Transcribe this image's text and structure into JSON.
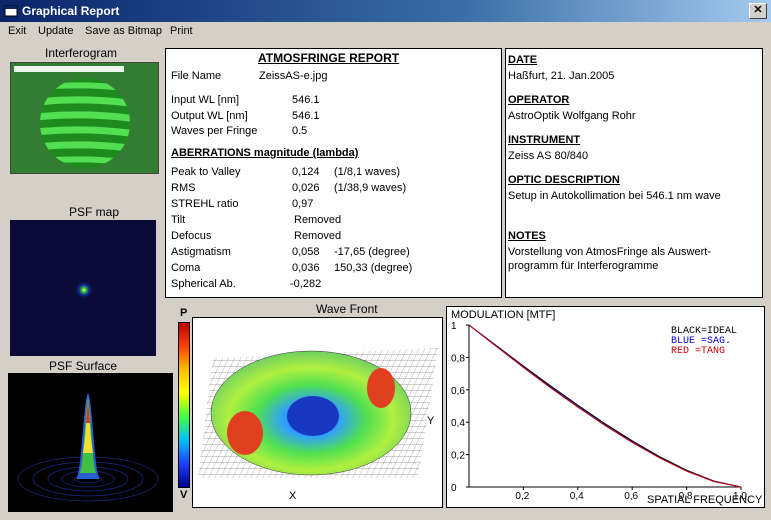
{
  "window": {
    "title": "Graphical Report",
    "close_glyph": "✕"
  },
  "menu": [
    "Exit",
    "Update",
    "Save as Bitmap",
    "Print"
  ],
  "thumbs": {
    "interferogram_label": "Interferogram",
    "psf_map_label": "PSF map",
    "psf_surface_label": "PSF Surface"
  },
  "report": {
    "title": "ATMOSFRINGE REPORT",
    "file_name_label": "File Name",
    "file_name_value": "ZeissAS-e.jpg",
    "input_wl_label": "Input  WL [nm]",
    "input_wl_value": "546.1",
    "output_wl_label": "Output WL [nm]",
    "output_wl_value": "546.1",
    "waves_label": "Waves per Fringe",
    "waves_value": "0.5",
    "aberr_title": "ABERRATIONS magnitude (lambda)",
    "rows": [
      {
        "label": "Peak to Valley",
        "value": "0,124",
        "extra": "(1/8,1 waves)"
      },
      {
        "label": "RMS",
        "value": "0,026",
        "extra": "(1/38,9 waves)"
      },
      {
        "label": "STREHL ratio",
        "value": "0,97",
        "extra": ""
      },
      {
        "label": "Tilt",
        "value": "Removed",
        "extra": ""
      },
      {
        "label": "Defocus",
        "value": "Removed",
        "extra": ""
      },
      {
        "label": "Astigmatism",
        "value": "0,058",
        "extra": "-17,65  (degree)"
      },
      {
        "label": "Coma",
        "value": "0,036",
        "extra": "150,33  (degree)"
      },
      {
        "label": "Spherical Ab.",
        "value": "-0,282",
        "extra": ""
      }
    ]
  },
  "info": {
    "date_label": "DATE",
    "date_value": "Haßfurt, 21. Jan.2005",
    "operator_label": "OPERATOR",
    "operator_value": "AstroOptik Wolfgang Rohr",
    "instrument_label": "INSTRUMENT",
    "instrument_value": "Zeiss AS  80/840",
    "optic_label": "OPTIC DESCRIPTION",
    "optic_value": "Setup in Autokollimation bei 546.1 nm wave",
    "notes_label": "NOTES",
    "notes_line1": "Vorstellung von AtmosFringe als Auswert-",
    "notes_line2": "programm für Interferogramme"
  },
  "wavefront": {
    "title": "Wave Front",
    "scale_top": "P",
    "scale_bottom": "V",
    "axis_x": "X",
    "axis_y": "Y"
  },
  "chart_data": {
    "type": "line",
    "title": "MODULATION    [MTF]",
    "xlabel": "SPATIAL FREQUENCY",
    "ylabel": "",
    "xlim": [
      0,
      1
    ],
    "ylim": [
      0,
      1
    ],
    "x_ticks": [
      "0,2",
      "0,4",
      "0,6",
      "0,8",
      "1,0"
    ],
    "y_ticks": [
      "0",
      "0,2",
      "0,4",
      "0,6",
      "0,8",
      "1"
    ],
    "legend": [
      "BLACK=IDEAL",
      "BLUE  =SAG.",
      "RED   =TANG"
    ],
    "x": [
      0,
      0.1,
      0.2,
      0.3,
      0.4,
      0.5,
      0.6,
      0.7,
      0.8,
      0.9,
      1.0
    ],
    "series": [
      {
        "name": "IDEAL",
        "color": "#000000",
        "values": [
          1.0,
          0.873,
          0.747,
          0.624,
          0.505,
          0.391,
          0.285,
          0.188,
          0.104,
          0.037,
          0.0
        ]
      },
      {
        "name": "SAG.",
        "color": "#0000cc",
        "values": [
          1.0,
          0.87,
          0.741,
          0.616,
          0.497,
          0.383,
          0.278,
          0.182,
          0.1,
          0.035,
          0.0
        ]
      },
      {
        "name": "TANG",
        "color": "#cc0000",
        "values": [
          1.0,
          0.868,
          0.738,
          0.612,
          0.493,
          0.38,
          0.275,
          0.18,
          0.098,
          0.034,
          0.0
        ]
      }
    ]
  }
}
